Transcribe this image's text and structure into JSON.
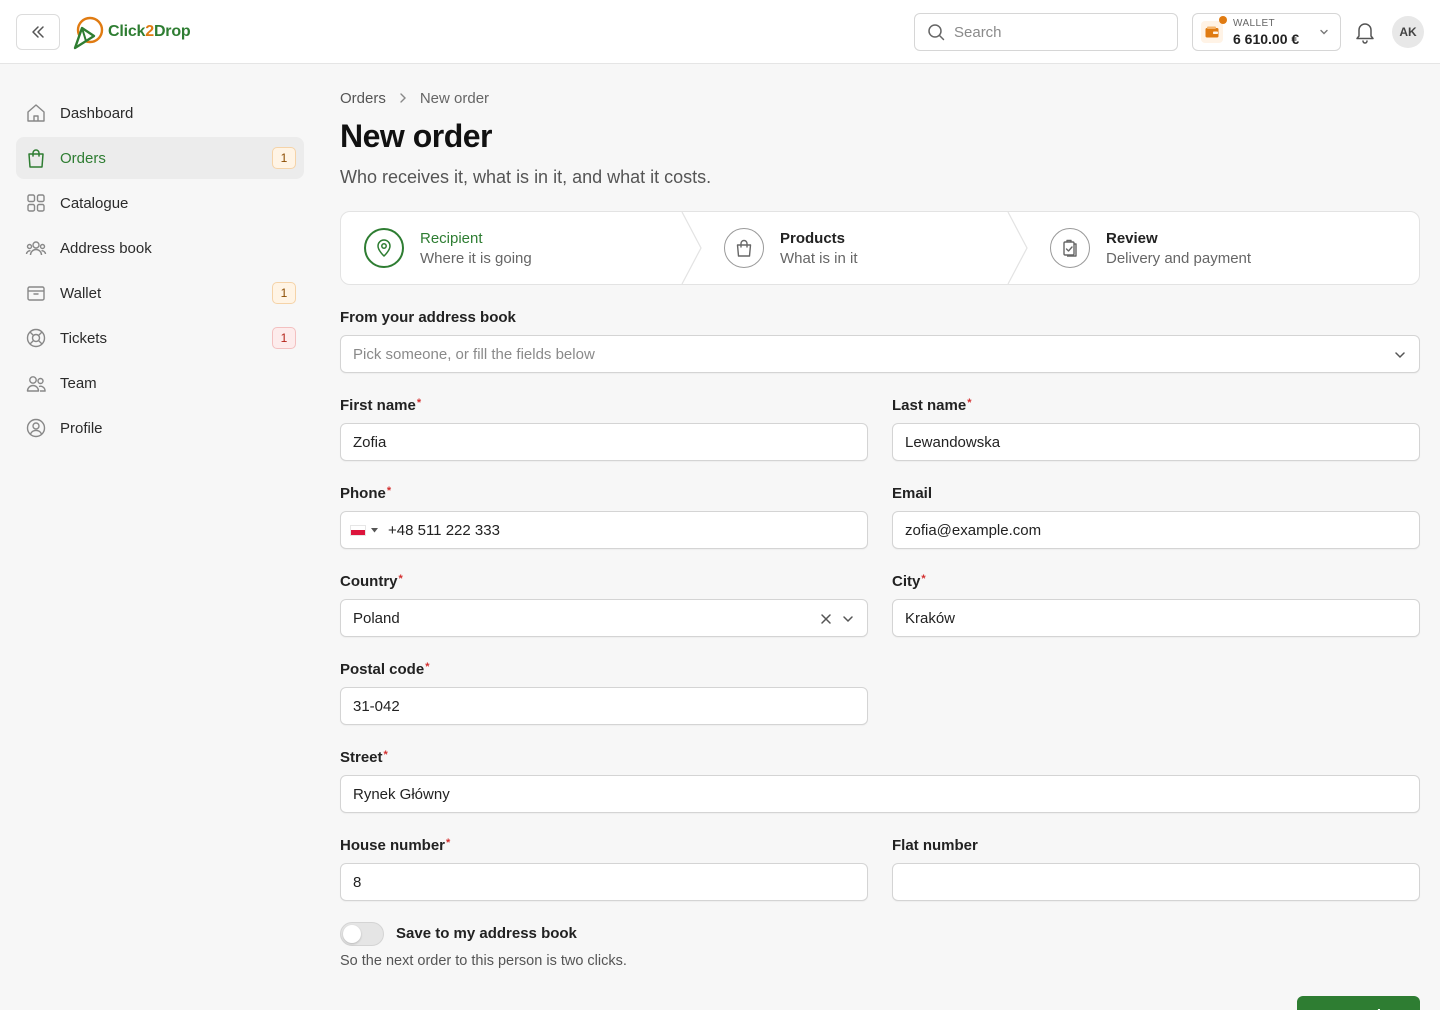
{
  "header": {
    "logo_text_a": "Click",
    "logo_text_b": "2",
    "logo_text_c": "Drop",
    "search_placeholder": "Search",
    "wallet_label": "WALLET",
    "wallet_amount": "6 610.00 €",
    "avatar_initials": "AK",
    "brand_green": "#2e7d32",
    "brand_orange": "#e07b12"
  },
  "sidebar": {
    "items": [
      {
        "label": "Dashboard",
        "icon": "home-icon",
        "active": false,
        "badge": ""
      },
      {
        "label": "Orders",
        "icon": "shopping-bag-icon",
        "active": true,
        "badge": "1"
      },
      {
        "label": "Catalogue",
        "icon": "grid-icon",
        "active": false,
        "badge": ""
      },
      {
        "label": "Address book",
        "icon": "users-group-icon",
        "active": false,
        "badge": ""
      },
      {
        "label": "Wallet",
        "icon": "wallet-icon",
        "active": false,
        "badge": "1"
      },
      {
        "label": "Tickets",
        "icon": "lifebuoy-icon",
        "active": false,
        "badge": "1"
      },
      {
        "label": "Team",
        "icon": "team-icon",
        "active": false,
        "badge": ""
      },
      {
        "label": "Profile",
        "icon": "user-circle-icon",
        "active": false,
        "badge": ""
      }
    ]
  },
  "breadcrumb": {
    "parent": "Orders",
    "current": "New order"
  },
  "page": {
    "title": "New order",
    "subtitle": "Who receives it, what is in it, and what it costs."
  },
  "steps": [
    {
      "title": "Recipient",
      "desc": "Where it is going",
      "icon": "map-pin-icon",
      "active": true
    },
    {
      "title": "Products",
      "desc": "What is in it",
      "icon": "shopping-bag-icon",
      "active": false
    },
    {
      "title": "Review",
      "desc": "Delivery and payment",
      "icon": "clipboard-check-icon",
      "active": false
    }
  ],
  "form": {
    "address_book_label": "From your address book",
    "address_book_placeholder": "Pick someone, or fill the fields below",
    "first_name_label": "First name",
    "first_name_value": "Zofia",
    "last_name_label": "Last name",
    "last_name_value": "Lewandowska",
    "phone_label": "Phone",
    "phone_value": "+48 511 222 333",
    "email_label": "Email",
    "email_value": "zofia@example.com",
    "country_label": "Country",
    "country_value": "Poland",
    "city_label": "City",
    "city_value": "Kraków",
    "postal_label": "Postal code",
    "postal_value": "31-042",
    "street_label": "Street",
    "street_value": "Rynek Główny",
    "house_label": "House number",
    "house_value": "8",
    "flat_label": "Flat number",
    "flat_value": "",
    "save_toggle_label": "Save to my address book",
    "save_toggle_on": false,
    "save_toggle_hint": "So the next order to this person is two clicks.",
    "required_mark": "*",
    "next_button": "Next: Products"
  }
}
